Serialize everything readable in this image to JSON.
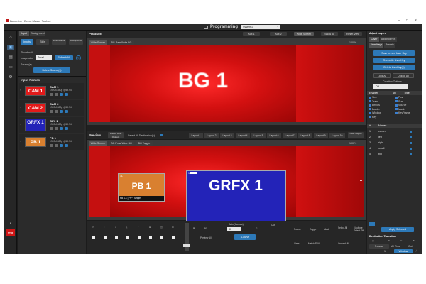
{
  "window": {
    "title": "Barco Inc | Event Master Toolset",
    "min": "–",
    "max": "□",
    "close": "×"
  },
  "header": {
    "title": "Programming",
    "system": "System1"
  },
  "left_panel": {
    "tabs": [
      "Input",
      "Background"
    ],
    "subtabs": [
      "Inputs",
      "Stills",
      "Destinations",
      "Backgrounds"
    ],
    "thumbnail_label": "Thumbnail",
    "image_size_label": "Image size",
    "image_size_value": "Small",
    "refresh_label": "Refresh All",
    "sources_label": "Source(s)",
    "delete_label": "Delete Source(s)",
    "input_names_title": "Input Names",
    "sources": [
      {
        "thumb": "CAM 1",
        "name": "CAM 1",
        "fmt": "1920x1080p @59.94",
        "color": "#e21a1a"
      },
      {
        "thumb": "CAM 2",
        "name": "CAM 2",
        "fmt": "1920x1080p @59.94",
        "color": "#e21a1a"
      },
      {
        "thumb": "GRFX 1",
        "name": "GFX 1",
        "fmt": "1920x1080p @59.94",
        "color": "#2323b8"
      },
      {
        "thumb": "PB 1",
        "name": "PB 1",
        "fmt": "1920x1080p @59.94",
        "color": "#d98030"
      }
    ]
  },
  "program": {
    "title": "Program",
    "buttons": [
      "Aux 1",
      "Aux 2",
      "Wide Screen",
      "Show All",
      "Reset View"
    ],
    "tabs": [
      "Wide Screen",
      "BG Pam Wide BG"
    ],
    "content": "BG 1",
    "zoom": "100 %"
  },
  "layers_bar": {
    "preview_label": "Preview",
    "preset_label": "Freeze Dest Outputs",
    "select_all_label": "Select All Destination(s)",
    "layouts": [
      "Layout 1",
      "Layout 2",
      "Layout 3",
      "Layout 4",
      "Layout 5",
      "Layout 6",
      "Layout 7",
      "Layout 8",
      "Layout 9",
      "Layout 10"
    ],
    "clear_label": "Clear Layout"
  },
  "preview": {
    "tabs": [
      "Wide Screen",
      "BG Prvw Wide BG",
      "BG Toggle"
    ],
    "pb_content": "PB 1",
    "pb_caption": "PB 1-1 | PIP | Single",
    "pb_tag": "1L",
    "grfx_content": "GRFX 1",
    "grfx_caption": "GFX 1-1 | PIP | Single",
    "grfx_tag": "1L",
    "zoom": "100 %"
  },
  "controls": {
    "auto_frames_label": "Auto(frames)",
    "frames_value": "30",
    "take_label": "S-curve",
    "labels": [
      "Freeze",
      "Toggle",
      "Mask",
      "Select All",
      "Multiple Select Off"
    ],
    "cut_label": "Cut",
    "preview_all": "Preview All",
    "clear_label": "Clear",
    "match_label": "Match PVW",
    "unmask_label": "Unmask All"
  },
  "right_panel": {
    "header": "Adjust Layers",
    "tabs": [
      "Layer",
      "Add Bkgrnds"
    ],
    "subtabs": [
      "User Keys",
      "Presets"
    ],
    "buttons": [
      "Save to new User Key",
      "Overwrite User Key",
      "Delete UserKey(s)"
    ],
    "lock_label": "Lock All",
    "unlock_label": "Unlock All",
    "creation_label": "Creation Options",
    "creation_value": "Off",
    "enabler_label": "Enabler",
    "all_label": "All",
    "type_label": "Type",
    "checks_left": [
      "Size",
      "Trans",
      "Effects",
      "Border",
      "Window",
      "Key"
    ],
    "checks_right": [
      "Pos",
      "Size",
      "Source",
      "Mask",
      "KeyFrame"
    ],
    "names_header": "Names",
    "names": [
      {
        "num": "1",
        "name": "center"
      },
      {
        "num": "2",
        "name": "left"
      },
      {
        "num": "3",
        "name": "right"
      },
      {
        "num": "4",
        "name": "small"
      },
      {
        "num": "5",
        "name": "big"
      }
    ],
    "apply_label": "Apply Selected",
    "transition_label": "Destination Transition",
    "transition_value": "S-curve",
    "all_time_label": "All Time",
    "cut_label": "Cut",
    "window_label": "Window"
  },
  "accent": "#2d79b8",
  "stop_label": "STOP"
}
